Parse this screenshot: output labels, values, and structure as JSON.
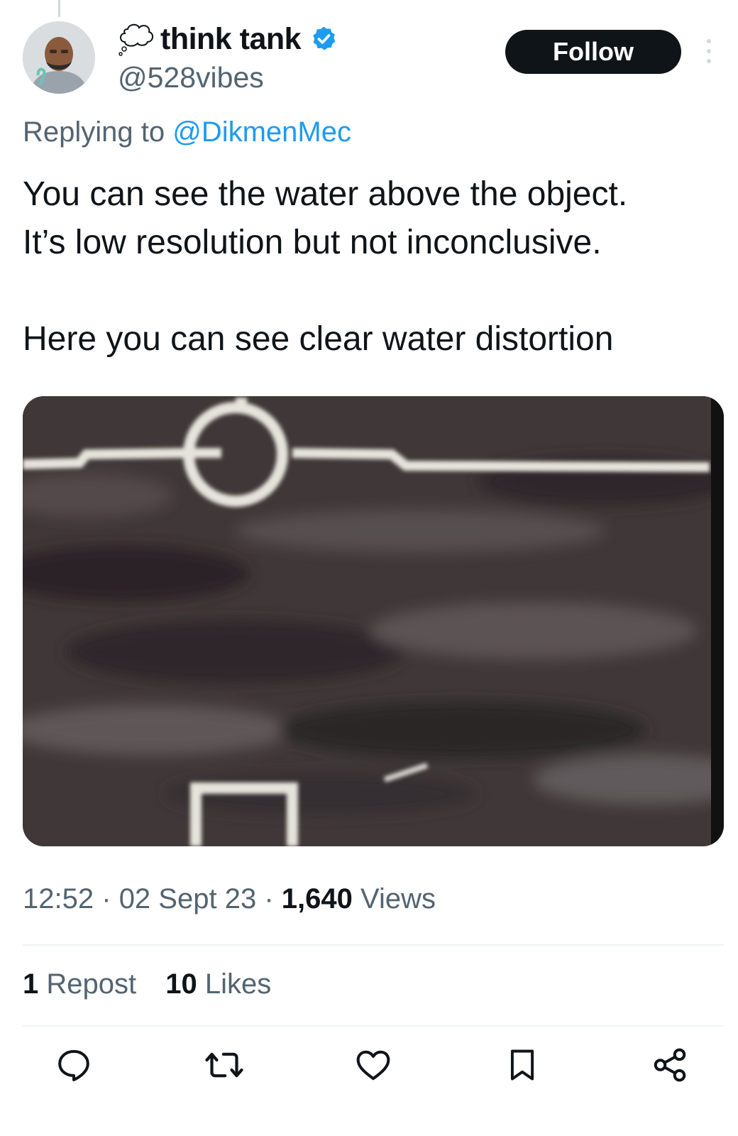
{
  "author": {
    "display_name": "think tank",
    "handle": "@528vibes",
    "verified": true
  },
  "follow_label": "Follow",
  "reply": {
    "prefix": "Replying to ",
    "to_handle": "@DikmenMec"
  },
  "tweet": {
    "paragraph1_line1": "You can see the water above the object.",
    "paragraph1_line2": "It’s low resolution but not inconclusive.",
    "paragraph2": "Here you can see clear water distortion"
  },
  "meta": {
    "time": "12:52",
    "date": "02 Sept 23",
    "views_count": "1,640",
    "views_label": "Views",
    "separator": "·"
  },
  "stats": {
    "reposts_count": "1",
    "reposts_label": "Repost",
    "likes_count": "10",
    "likes_label": "Likes"
  },
  "colors": {
    "accent": "#1d9bf0",
    "text_primary": "#0f1419",
    "text_secondary": "#536471",
    "button_bg": "#0f1419"
  },
  "icons": [
    "thought-bubble-icon",
    "verified-badge-icon",
    "more-icon",
    "reply-icon",
    "repost-icon",
    "like-icon",
    "bookmark-icon",
    "share-icon"
  ]
}
